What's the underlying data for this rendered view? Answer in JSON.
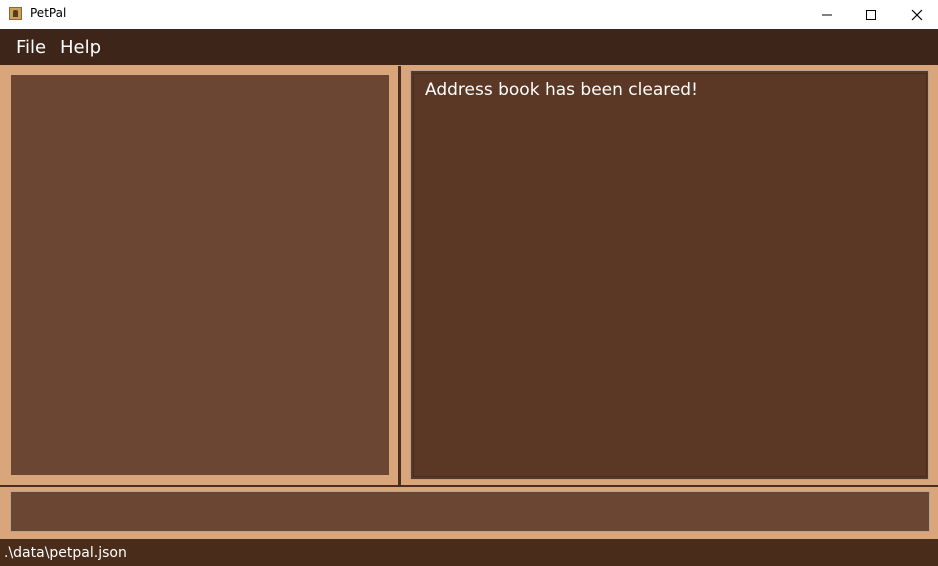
{
  "window": {
    "title": "PetPal",
    "app_icon": "address-book-icon",
    "controls": [
      "minimize-icon",
      "maximize-icon",
      "close-icon"
    ]
  },
  "menu": {
    "file": "File",
    "help": "Help"
  },
  "result_display": {
    "message": "Address book has been cleared!"
  },
  "command_box": {
    "value": "",
    "placeholder": ""
  },
  "status_bar": {
    "path": ".\\data\\petpal.json"
  },
  "colors": {
    "menubar": "#3d2519",
    "panel_bg": "#d9a57a",
    "list_bg": "#6b4633",
    "result_bg": "#5b3726",
    "statusbar": "#4a2c1a"
  }
}
